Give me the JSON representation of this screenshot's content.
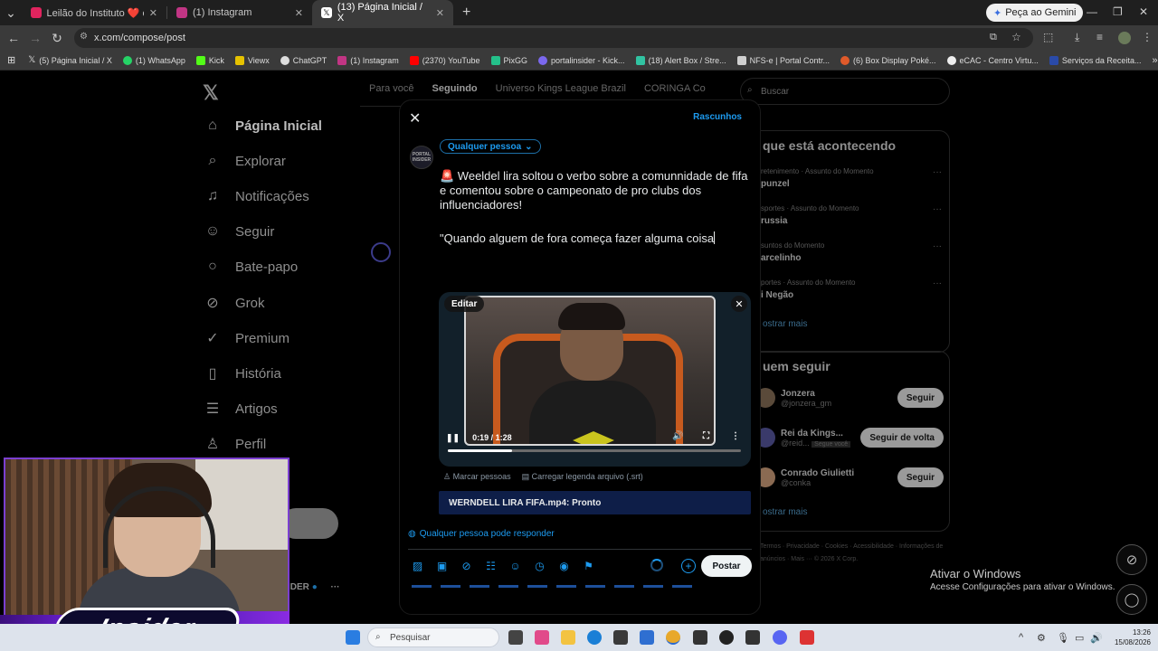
{
  "browser": {
    "tabs": [
      {
        "title": "Leilão do Instituto ❤️ e viagem",
        "active": false,
        "icon_color": "#e0245e"
      },
      {
        "title": "(1) Instagram",
        "active": false,
        "icon_color": "#c13584"
      },
      {
        "title": "(13) Página Inicial / X",
        "active": true,
        "icon_color": "#222222"
      }
    ],
    "gemini_label": "Peça ao Gemini",
    "url": "x.com/compose/post",
    "bookmarks": [
      "(5) Página Inicial / X",
      "(1) WhatsApp",
      "Kick",
      "Viewx",
      "ChatGPT",
      "(1) Instagram",
      "(2370) YouTube",
      "PixGG",
      "portalinsider - Kick...",
      "(18) Alert Box / Stre...",
      "NFS-e | Portal Contr...",
      "(6) Box Display Poké...",
      "eCAC - Centro Virtu...",
      "Serviços da Receita..."
    ]
  },
  "sidebar": {
    "items": [
      {
        "label": "Página Inicial",
        "icon": "home-icon"
      },
      {
        "label": "Explorar",
        "icon": "search-icon"
      },
      {
        "label": "Notificações",
        "icon": "bell-icon"
      },
      {
        "label": "Seguir",
        "icon": "person-add-icon"
      },
      {
        "label": "Bate-papo",
        "icon": "chat-icon"
      },
      {
        "label": "Grok",
        "icon": "grok-icon"
      },
      {
        "label": "Premium",
        "icon": "verified-icon"
      },
      {
        "label": "História",
        "icon": "bookmark-icon"
      },
      {
        "label": "Artigos",
        "icon": "article-icon"
      },
      {
        "label": "Perfil",
        "icon": "person-icon"
      }
    ],
    "profile_fragment": "IDER"
  },
  "feed": {
    "tabs": [
      "Para você",
      "Seguindo",
      "Universo Kings League Brazil",
      "CORINGA Co"
    ]
  },
  "right": {
    "search_placeholder": "Buscar",
    "trends_title": "que está acontecendo",
    "trends": [
      {
        "meta": "retenimento · Assunto do Momento",
        "name": "punzel"
      },
      {
        "meta": "sportes · Assunto do Momento",
        "name": "russia"
      },
      {
        "meta": "suntos do Momento",
        "name": "arcelinho"
      },
      {
        "meta": "portes · Assunto do Momento",
        "name": "i Negão"
      }
    ],
    "show_more": "ostrar mais",
    "follow_title": "uem seguir",
    "follow": [
      {
        "name": "Jonzera",
        "handle": "@jonzera_gm",
        "button": "Seguir"
      },
      {
        "name": "Rei da Kings...",
        "handle": "@reid...",
        "extra": "Segue você",
        "button": "Seguir de volta"
      },
      {
        "name": "Conrado Giulietti",
        "handle": "@conka",
        "button": "Seguir"
      }
    ],
    "show_more_2": "ostrar mais",
    "footer": "Termos · Privacidade · Cookies · Acessibilidade · Informações de anúncios · Mais ··· © 2026 X Corp."
  },
  "compose": {
    "drafts_label": "Rascunhos",
    "avatar_text": "PORTAL INSIDER",
    "audience_label": "Qualquer pessoa",
    "text_line1": "🚨 Weeldel lira soltou o verbo sobre a comunnidade de fifa e comentou sobre o campeonato de pro clubs dos influenciadores!",
    "text_line2": "\"Quando alguem de fora começa fazer alguma coisa",
    "edit_label": "Editar",
    "video_time": "0:19 / 1:28",
    "video_progress": 0.22,
    "tag_people": "Marcar pessoas",
    "caption_upload": "Carregar legenda arquivo (.srt)",
    "upload_status": "WERNDELL LIRA FIFA.mp4: Pronto",
    "reply_scope": "Qualquer pessoa pode responder",
    "post_label": "Postar"
  },
  "overlay": {
    "brand": "Insider"
  },
  "windows": {
    "activate_title": "Ativar o Windows",
    "activate_sub": "Acesse Configurações para ativar o Windows.",
    "taskbar_search": "Pesquisar",
    "time": "13:26",
    "date": "15/08/2026"
  },
  "colors": {
    "accent": "#1d9bf0",
    "overlay_border": "#7b3fd0"
  }
}
